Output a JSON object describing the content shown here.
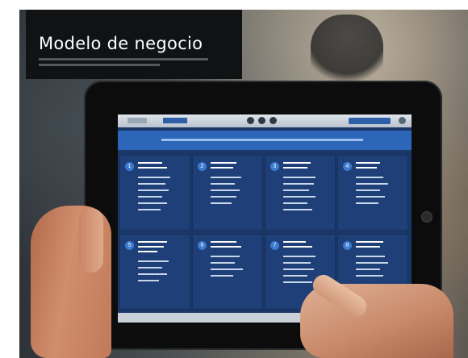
{
  "slide": {
    "title": "Modelo de negocio"
  },
  "tablet_screen": {
    "cells": [
      {
        "number": "1"
      },
      {
        "number": "2"
      },
      {
        "number": "3"
      },
      {
        "number": "4"
      },
      {
        "number": "5"
      },
      {
        "number": "6"
      },
      {
        "number": "7"
      },
      {
        "number": "8"
      }
    ]
  },
  "colors": {
    "screen_background": "#1a3768",
    "header_bar": "#2c66b8",
    "title_box": "#111213"
  },
  "icons": [
    "camera-icon"
  ]
}
